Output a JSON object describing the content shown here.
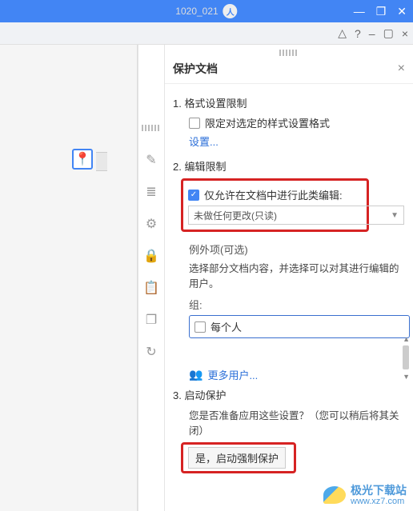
{
  "titlebar": {
    "title": "1020_021"
  },
  "pin": {
    "glyph": "📍"
  },
  "panel": {
    "title": "保护文档",
    "section1": {
      "label": "1. 格式设置限制",
      "checkbox_label": "限定对选定的样式设置格式",
      "settings_link": "设置..."
    },
    "section2": {
      "label": "2. 编辑限制",
      "checkbox_label": "仅允许在文档中进行此类编辑:",
      "dropdown_value": "未做任何更改(只读)",
      "exceptions_label": "例外项(可选)",
      "exceptions_desc": "选择部分文档内容，并选择可以对其进行编辑的用户。",
      "group_label": "组:",
      "group_item": "每个人",
      "more_users": "更多用户..."
    },
    "section3": {
      "label": "3. 启动保护",
      "prompt": "您是否准备应用这些设置？（您可以稍后将其关闭）",
      "button": "是，启动强制保护"
    }
  },
  "watermark": {
    "line1": "极光下载站",
    "line2": "www.xz7.com"
  }
}
